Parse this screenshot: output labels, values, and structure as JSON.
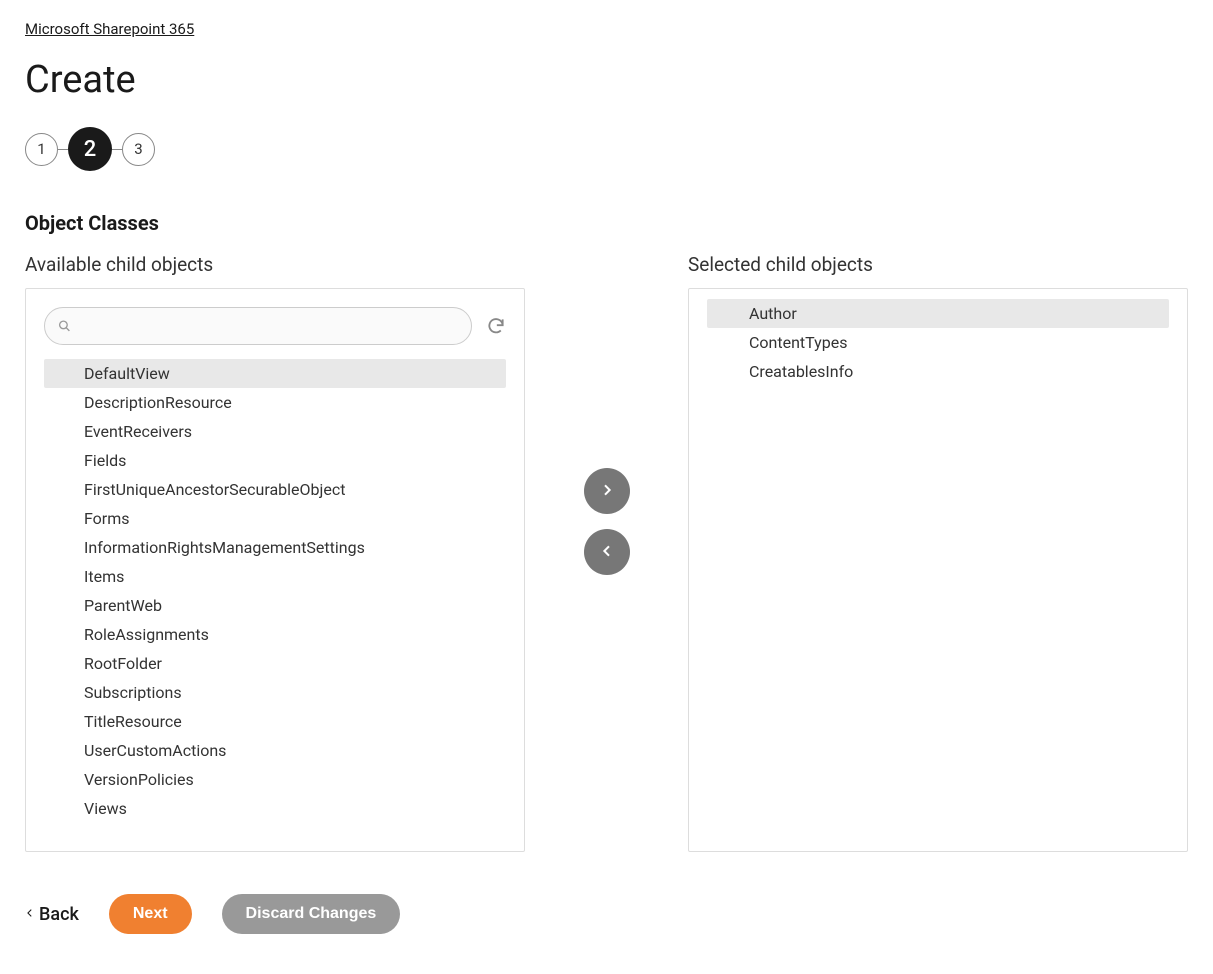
{
  "breadcrumb": {
    "label": "Microsoft Sharepoint 365"
  },
  "page": {
    "title": "Create"
  },
  "stepper": {
    "steps": [
      "1",
      "2",
      "3"
    ],
    "active_index": 1
  },
  "section": {
    "title": "Object Classes"
  },
  "available": {
    "header": "Available child objects",
    "search_placeholder": "",
    "items": [
      {
        "label": "DefaultView",
        "highlighted": true
      },
      {
        "label": "DescriptionResource",
        "highlighted": false
      },
      {
        "label": "EventReceivers",
        "highlighted": false
      },
      {
        "label": "Fields",
        "highlighted": false
      },
      {
        "label": "FirstUniqueAncestorSecurableObject",
        "highlighted": false
      },
      {
        "label": "Forms",
        "highlighted": false
      },
      {
        "label": "InformationRightsManagementSettings",
        "highlighted": false
      },
      {
        "label": "Items",
        "highlighted": false
      },
      {
        "label": "ParentWeb",
        "highlighted": false
      },
      {
        "label": "RoleAssignments",
        "highlighted": false
      },
      {
        "label": "RootFolder",
        "highlighted": false
      },
      {
        "label": "Subscriptions",
        "highlighted": false
      },
      {
        "label": "TitleResource",
        "highlighted": false
      },
      {
        "label": "UserCustomActions",
        "highlighted": false
      },
      {
        "label": "VersionPolicies",
        "highlighted": false
      },
      {
        "label": "Views",
        "highlighted": false
      }
    ]
  },
  "selected": {
    "header": "Selected child objects",
    "items": [
      {
        "label": "Author",
        "highlighted": true
      },
      {
        "label": "ContentTypes",
        "highlighted": false
      },
      {
        "label": "CreatablesInfo",
        "highlighted": false
      }
    ]
  },
  "footer": {
    "back": "Back",
    "next": "Next",
    "discard": "Discard Changes"
  }
}
